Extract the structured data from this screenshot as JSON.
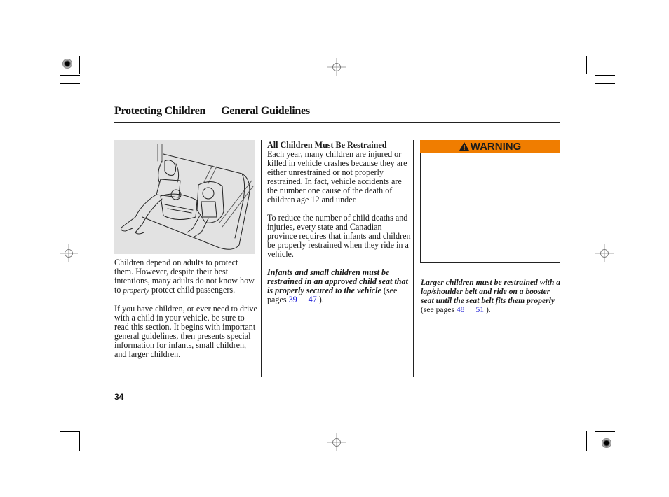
{
  "header": {
    "section": "Protecting Children",
    "subsection": "General Guidelines"
  },
  "figure": {
    "alt": "Adult seated beside an infant in a rear-facing child seat and a child in a forward-facing child seat on a rear vehicle seat"
  },
  "column1": {
    "para1_a": "Children depend on adults to protect them. However, despite their best intentions, many adults do not know how to ",
    "para1_em": "properly",
    "para1_b": " protect child passengers.",
    "para2": "If you have children, or ever need to drive with a child in your vehicle, be sure to read this section. It begins with important general guidelines, then presents special information for infants, small children, and larger children."
  },
  "column2": {
    "heading": "All Children Must Be Restrained",
    "para1": "Each year, many children are injured or killed in vehicle crashes because they are either unrestrained or not properly restrained. In fact, vehicle accidents are the number one cause of the death of children age 12 and under.",
    "para2": "To reduce the number of child deaths and injuries, every state and Canadian province requires that infants and children be properly restrained when they ride in a vehicle.",
    "para3_bold": "Infants and small children must be restrained in an approved child seat that is properly secured to the vehicle",
    "para3_pre": " (see pages ",
    "link1": "39",
    "link2": "47",
    "para3_post": " )."
  },
  "column3": {
    "warning_label": "WARNING",
    "warning_icon": "warning-triangle-icon",
    "para_bold": "Larger children must be restrained with a lap/shoulder belt and ride on a booster seat until the seat belt fits them properly",
    "para_pre": " (see pages ",
    "link1": "48",
    "link2": "51",
    "para_post": " )."
  },
  "footer": {
    "page_number": "34"
  },
  "colors": {
    "warning_orange": "#f07d00",
    "link_blue": "#1a1ad6",
    "figure_bg": "#e2e2e2"
  }
}
